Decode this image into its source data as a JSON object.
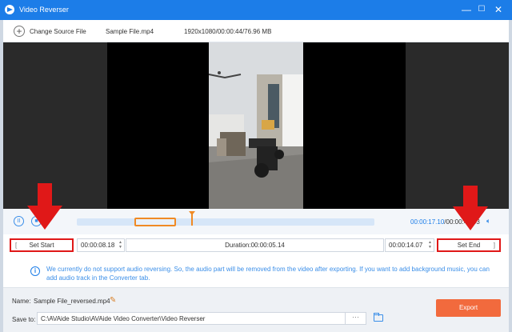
{
  "window": {
    "title": "Video Reverser",
    "controls": {
      "minimize": "—",
      "maximize": "☐",
      "close": "✕"
    }
  },
  "topbar": {
    "change_source_label": "Change Source File",
    "file_name": "Sample File.mp4",
    "file_info": "1920x1080/00:00:44/76.96 MB"
  },
  "playback": {
    "current_time": "00:00:17.10",
    "separator": "/",
    "total_time": "00:00:44.03",
    "progress": 0.39
  },
  "trim": {
    "set_start_label": "Set Start",
    "set_end_label": "Set End",
    "start_time": "00:00:08.18",
    "end_time": "00:00:14.07",
    "duration_text": "Duration:00:00:05.14",
    "start_bracket": "[",
    "end_bracket": "]"
  },
  "notice": {
    "text": "We currently do not support audio reversing. So, the audio part will be removed from the video after exporting. If you want to add background music, you can add audio track in the Converter tab."
  },
  "output": {
    "name_label": "Name:",
    "name_value": "Sample File_reversed.mp4",
    "save_label": "Save to:",
    "save_path": "C:\\AVAide Studio\\AVAide Video Converter\\Video Reverser",
    "browse_label": "···",
    "export_label": "Export"
  },
  "colors": {
    "titlebar": "#1c7de8",
    "accent": "#1c7de8",
    "export": "#f26a3d",
    "highlight": "#e01818",
    "timeline_selection": "#f08a24"
  }
}
